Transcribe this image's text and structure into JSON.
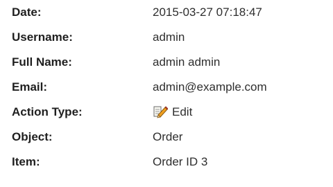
{
  "details": {
    "date": {
      "label": "Date:",
      "value": "2015-03-27 07:18:47"
    },
    "username": {
      "label": "Username:",
      "value": "admin"
    },
    "full_name": {
      "label": "Full Name:",
      "value": "admin admin"
    },
    "email": {
      "label": "Email:",
      "value": "admin@example.com"
    },
    "action_type": {
      "label": "Action Type:",
      "value": "Edit",
      "icon": "edit-icon"
    },
    "object": {
      "label": "Object:",
      "value": "Order"
    },
    "item": {
      "label": "Item:",
      "value": "Order ID 3"
    }
  }
}
